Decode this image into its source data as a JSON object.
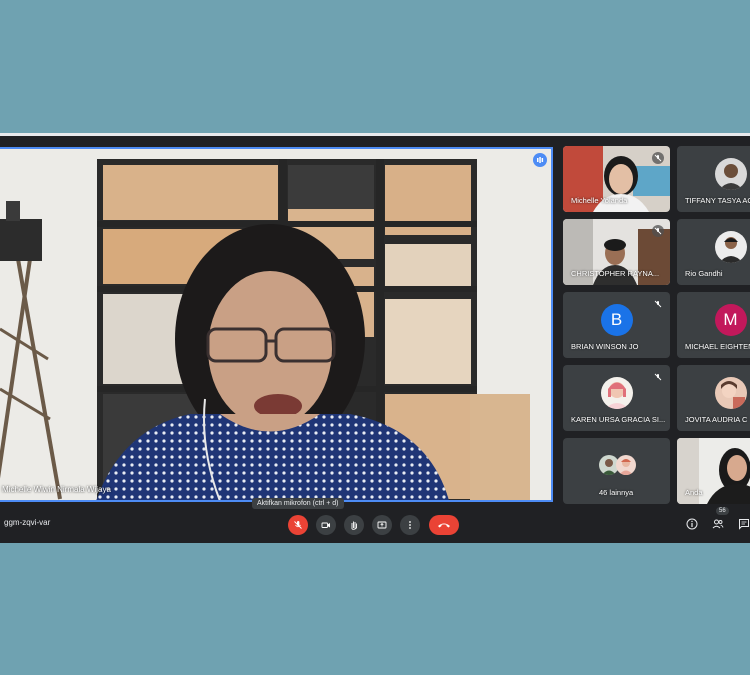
{
  "meeting": {
    "code": "ggm-zqvi-var",
    "main_speaker_name": "Michelle Wiwin Nirmala Wijaya",
    "tooltip": "Aktifkan mikrofon (ctrl + d)",
    "participant_count": "56"
  },
  "tiles": [
    {
      "name": "Michelle Yolanda",
      "type": "photo"
    },
    {
      "name": "TIFFANY TASYA AG",
      "type": "avatar-photo"
    },
    {
      "name": "CHRISTOPHER RAYNA...",
      "type": "photo"
    },
    {
      "name": "Rio Gandhi",
      "type": "avatar-photo"
    },
    {
      "name": "BRIAN WINSON JO",
      "type": "letter",
      "letter": "B",
      "color": "#1a73e8"
    },
    {
      "name": "MICHAEL EIGHTEN",
      "type": "letter",
      "letter": "M",
      "color": "#c2185b"
    },
    {
      "name": "KAREN URSA GRACIA SI...",
      "type": "avatar-photo"
    },
    {
      "name": "JOVITA AUDRIA C",
      "type": "avatar-photo"
    },
    {
      "name": "46 lainnya",
      "type": "others"
    },
    {
      "name": "Anda",
      "type": "photo"
    }
  ],
  "colors": {
    "speaking_border": "#4d8cf5",
    "mic_off_red": "#ea4335",
    "toolbar_bg": "#202124",
    "page_bg": "#6fa2b1"
  },
  "icons": [
    "mic-off-icon",
    "camera-icon",
    "raise-hand-icon",
    "present-icon",
    "more-options-icon",
    "end-call-icon",
    "info-icon",
    "people-icon",
    "chat-icon",
    "speaking-indicator-icon"
  ]
}
